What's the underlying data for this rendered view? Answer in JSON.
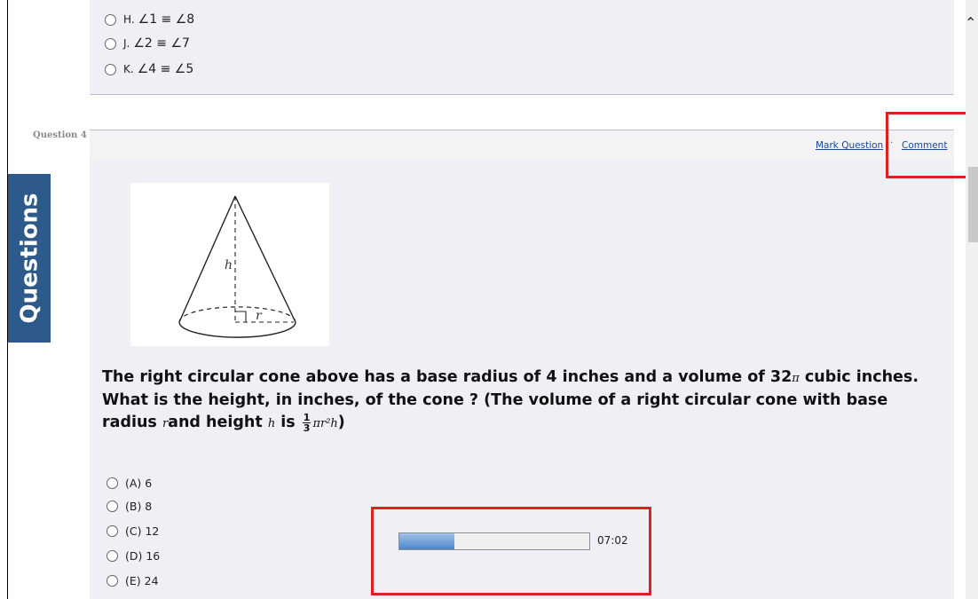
{
  "previous_question": {
    "options": [
      {
        "letter": "H.",
        "text": "∠1 ≡ ∠8"
      },
      {
        "letter": "J.",
        "text": "∠2 ≡ ∠7"
      },
      {
        "letter": "K.",
        "text": "∠4 ≡ ∠5"
      }
    ]
  },
  "side_tab": {
    "label": "Questions"
  },
  "question": {
    "number_label": "Question 4",
    "links": {
      "mark": "Mark Question",
      "comment": "Comment"
    },
    "figure_labels": {
      "height": "h",
      "radius": "r"
    },
    "text_part1": "The right circular cone above has a base radius of 4 inches and a volume of 32",
    "pi": "π",
    "text_part2": " cubic inches. What is the height, in inches, of the cone ? (The volume of a right circular cone with base radius ",
    "var_r": "r",
    "text_part3": "and height ",
    "var_h": "h",
    "text_part4": " is ",
    "frac_num": "1",
    "frac_den": "3",
    "formula": "πr²h",
    "text_part5": ")",
    "answers": [
      "(A) 6",
      "(B) 8",
      "(C) 12",
      "(D) 16",
      "(E) 24"
    ]
  },
  "timer": {
    "value": "07:02",
    "progress_fraction": 0.29
  },
  "colors": {
    "highlight": "#e02020",
    "side_tab": "#2d5a8a",
    "link": "#1a4aa0"
  }
}
